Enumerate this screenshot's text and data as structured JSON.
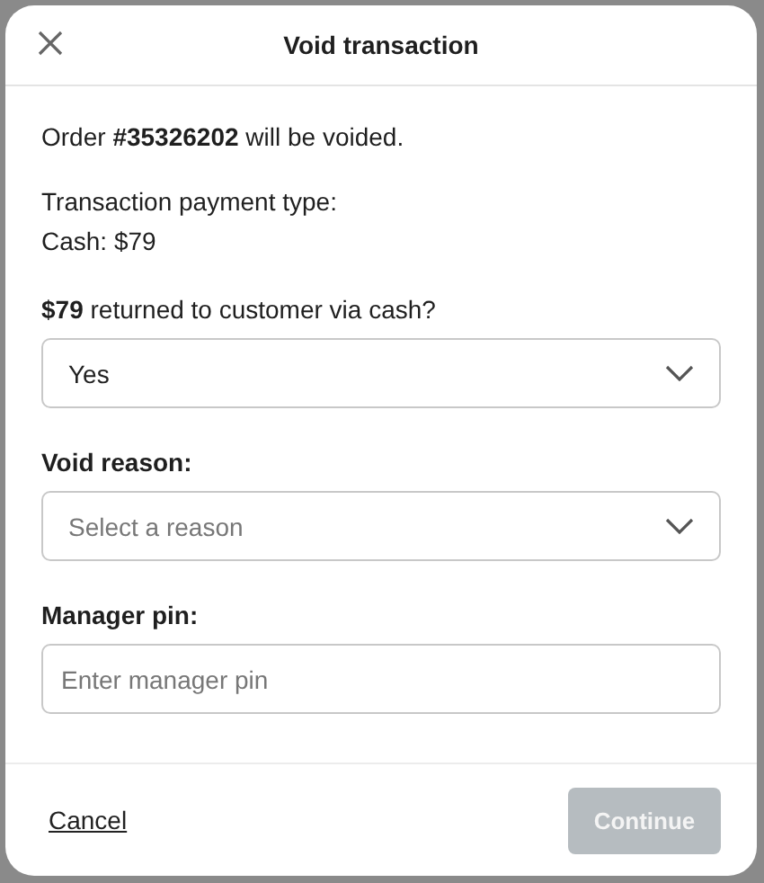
{
  "dialog": {
    "title": "Void transaction",
    "intro": "Order **#35326202** will be voided.",
    "payment_label": "Transaction payment type:",
    "payment_value": "Cash: $79",
    "fields": [
      {
        "kind": "select",
        "label": "**$79** returned to customer via cash?",
        "value": "Yes"
      },
      {
        "kind": "select",
        "label": "Void reason:",
        "placeholder": "Select a reason"
      },
      {
        "kind": "input",
        "label": "Manager pin:",
        "placeholder": "Enter manager pin"
      }
    ],
    "cancel": "Cancel",
    "continue": {
      "label": "Continue",
      "disabled": true
    }
  }
}
